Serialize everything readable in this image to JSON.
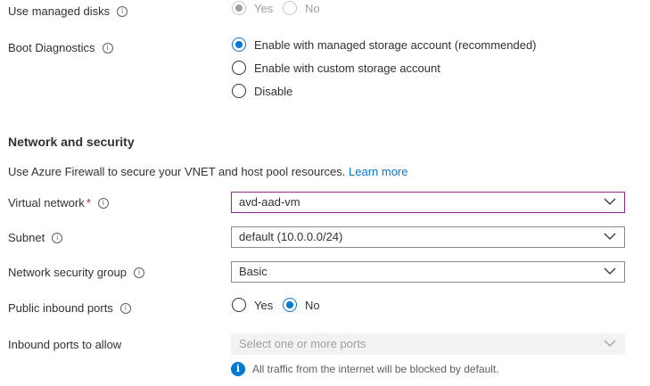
{
  "managed_disks": {
    "label": "Use managed disks",
    "options": [
      "Yes",
      "No"
    ],
    "selected": "Yes",
    "disabled": true
  },
  "boot_diagnostics": {
    "label": "Boot Diagnostics",
    "options": [
      "Enable with managed storage account (recommended)",
      "Enable with custom storage account",
      "Disable"
    ],
    "selected": "Enable with managed storage account (recommended)"
  },
  "network": {
    "title": "Network and security",
    "description": "Use Azure Firewall to secure your VNET and host pool resources.",
    "learn_more": "Learn more"
  },
  "virtual_network": {
    "label": "Virtual network",
    "required_mark": "*",
    "value": "avd-aad-vm"
  },
  "subnet": {
    "label": "Subnet",
    "value": "default (10.0.0.0/24)"
  },
  "nsg": {
    "label": "Network security group",
    "value": "Basic"
  },
  "public_inbound": {
    "label": "Public inbound ports",
    "options": [
      "Yes",
      "No"
    ],
    "selected": "No"
  },
  "inbound_allow": {
    "label": "Inbound ports to allow",
    "placeholder": "Select one or more ports",
    "note": "All traffic from the internet will be blocked by default."
  },
  "icons": {
    "info": "info-icon",
    "chevron": "chevron-down-icon",
    "notice": "info-filled-icon"
  },
  "colors": {
    "accent": "#0078d4",
    "focus_border": "#8a2b8f",
    "required": "#a4262c"
  }
}
